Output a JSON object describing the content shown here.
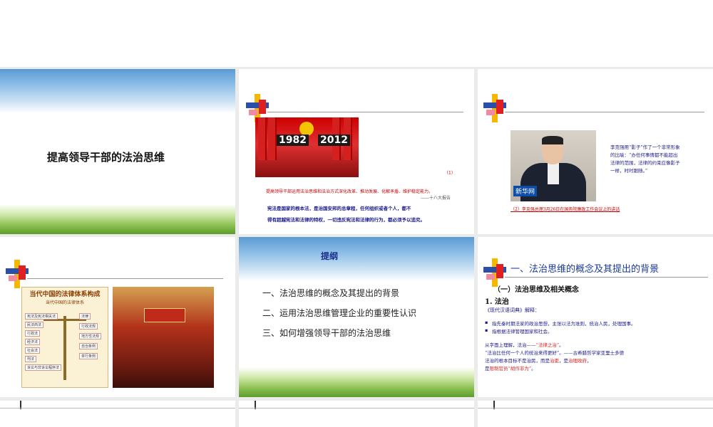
{
  "slides": [
    {
      "title": "提高领导干部的法治思维"
    },
    {
      "photo_years": [
        "1982",
        "2012"
      ],
      "caption": "（1）",
      "quote": "提高领导干部运用法治思维和法治方式深化改革、推动发展、化解矛盾、维护稳定能力。",
      "source": "——十八大报告",
      "body_line1": "宪法是国家的根本法，是治国安邦的总章程，任何组织或者个人，都不",
      "body_line2": "得有超越宪法和法律的特权，一切违反宪法和法律的行为，都必须予以追究。"
    },
    {
      "photo_logo": "新华网",
      "quote": "李克强用“影子”作了一个非常形象的比喻：“办任何事情都不能超出法律的范围，法律的约束应像影子一样，时时跟随。”",
      "caption": "（2）李克强总理3月26日在国务院廉政工作会议上的讲话"
    },
    {
      "chart_title": "当代中国的法律体系构成",
      "chart_subtitle": "当代中国的法律体系",
      "chart_left": [
        "宪法及宪法相关法",
        "民法商法",
        "行政法",
        "经济法",
        "社会法",
        "刑法",
        "诉讼与非诉讼程序法"
      ],
      "chart_right": [
        "法律",
        "行政法规",
        "地方性法规",
        "自治条例",
        "单行条例"
      ]
    },
    {
      "heading": "提纲",
      "items": [
        "一、法治思维的概念及其提出的背景",
        "二、运用法治思维管理企业的重要性认识",
        "三、如何增强领导干部的法治思维"
      ]
    },
    {
      "heading": "一、法治思维的概念及其提出的背景",
      "subheading": "（一）法治思维及相关概念",
      "point": "1. 法治",
      "dict": "《现代汉语词典》解释：",
      "bullets": [
        "指先秦时期法家的政治思想，主张以法为准则，统治人民，处理国事。",
        "指根据法律管理国家和社会。"
      ],
      "line1_a": "从字面上理解，法治——",
      "line1_b": "“法律之治”",
      "line1_c": "。",
      "line2": "“法治比任何一个人的统治来得更好”。——古希腊哲学家亚里士多德",
      "line3_a": "法治的根本目标不是治民，而是",
      "line3_b": "治吏",
      "line3_c": "，是",
      "line3_d": "治理政府",
      "line3_e": "，",
      "line4_a": "是",
      "line4_b": "限制官员“胡作非为”",
      "line4_c": "。"
    }
  ],
  "colors": {
    "accent_blue": "#1a3a9c",
    "accent_red": "#e02020",
    "sky": "#5a9bd4",
    "grass": "#5d9b2c"
  }
}
